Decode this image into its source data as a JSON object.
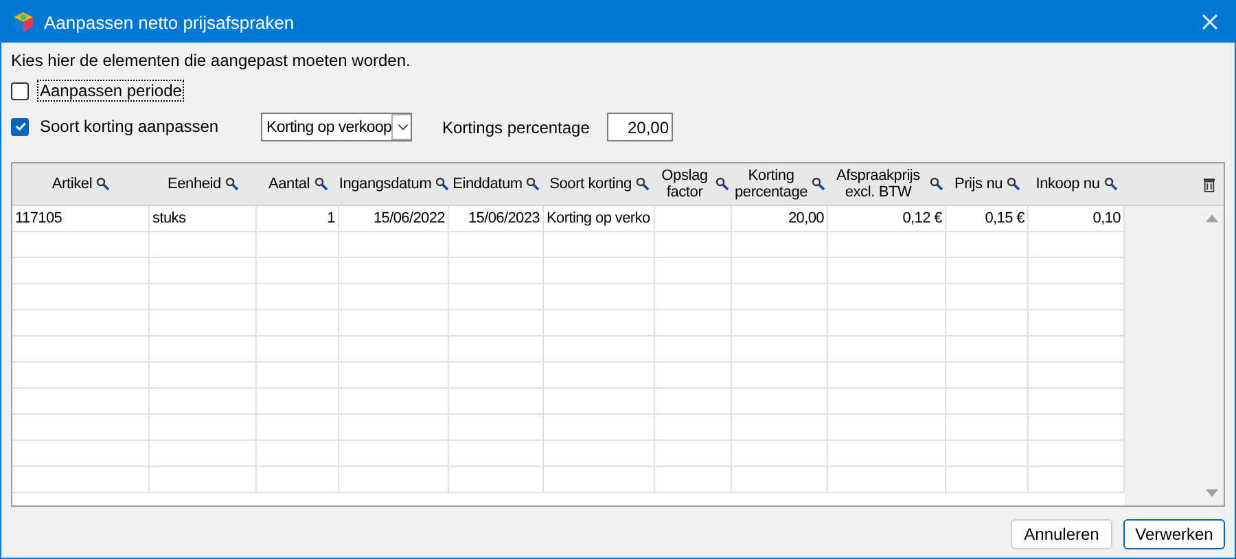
{
  "window": {
    "title": "Aanpassen netto prijsafspraken"
  },
  "instruction": "Kies hier de elementen die aangepast moeten worden.",
  "options": [
    {
      "label": "Aanpassen periode",
      "checked": false,
      "focused": true
    },
    {
      "label": "Soort korting aanpassen",
      "checked": true,
      "focused": false
    }
  ],
  "discount_type": {
    "value": "Korting op verkoop"
  },
  "discount_percentage": {
    "label": "Kortings percentage",
    "value": "20,00"
  },
  "table": {
    "columns": [
      "Artikel",
      "Eenheid",
      "Aantal",
      "Ingangsdatum",
      "Einddatum",
      "Soort korting",
      "Opslag factor",
      "Korting percentage",
      "Afspraakprijs excl. BTW",
      "Prijs nu",
      "Inkoop nu"
    ],
    "rows": [
      [
        "117105",
        "stuks",
        "1",
        "15/06/2022",
        "15/06/2023",
        "Korting op verko",
        "",
        "20,00",
        "0,12 €",
        "0,15 €",
        "0,10"
      ]
    ]
  },
  "buttons": [
    "Annuleren",
    "Verwerken"
  ]
}
